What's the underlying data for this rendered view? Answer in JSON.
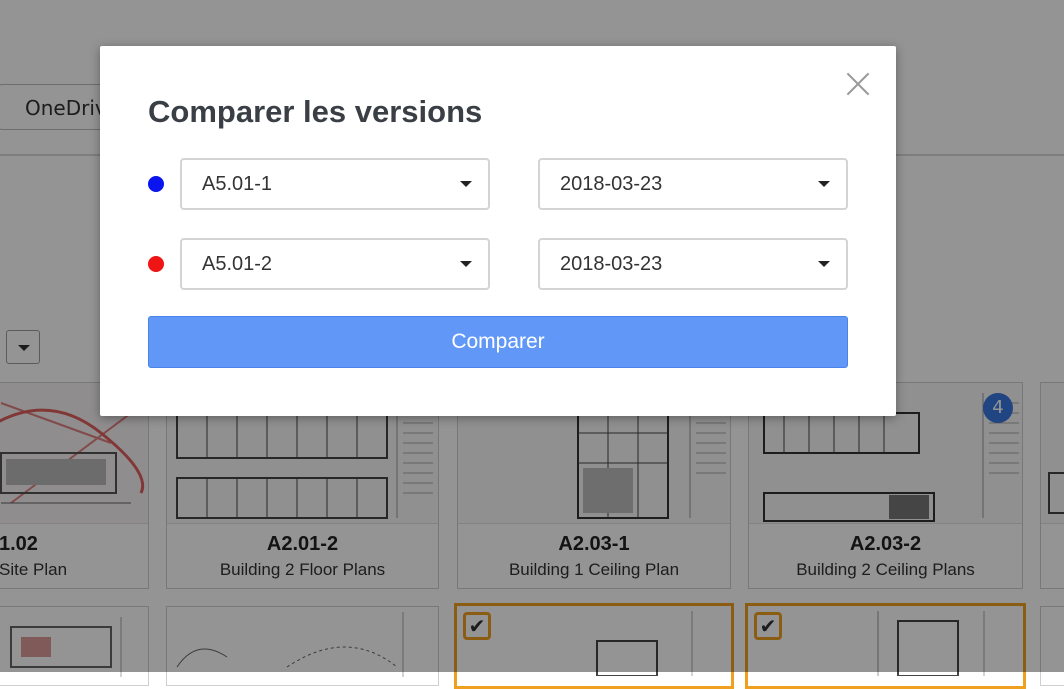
{
  "background": {
    "source_button_label": "OneDrive",
    "cards_row1": [
      {
        "code": "1.02",
        "name": "Site Plan",
        "badge": ""
      },
      {
        "code": "A2.01-2",
        "name": "Building 2 Floor Plans",
        "badge": ""
      },
      {
        "code": "A2.03-1",
        "name": "Building 1 Ceiling Plan",
        "badge": ""
      },
      {
        "code": "A2.03-2",
        "name": "Building 2 Ceiling Plans",
        "badge": "4"
      }
    ],
    "cards_row2_checkmarks": [
      "✔",
      "✔"
    ]
  },
  "modal": {
    "title": "Comparer les versions",
    "rows": [
      {
        "dot_color": "#0a14f0",
        "sheet": "A5.01-1",
        "date": "2018-03-23"
      },
      {
        "dot_color": "#f01414",
        "sheet": "A5.01-2",
        "date": "2018-03-23"
      }
    ],
    "compare_label": "Comparer"
  },
  "colors": {
    "accent": "#6198f8",
    "selection": "#f0a020",
    "badge": "#3a78e0"
  }
}
